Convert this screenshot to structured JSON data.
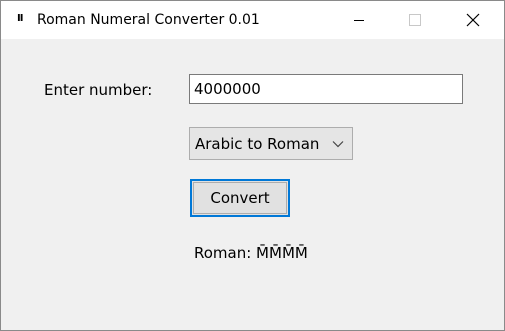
{
  "window": {
    "title": "Roman Numeral Converter 0.01",
    "app_icon_glyph": "II",
    "controls": {
      "minimize_icon": "minimize-icon",
      "maximize_icon": "maximize-icon",
      "close_icon": "close-icon"
    }
  },
  "form": {
    "number_label": "Enter number:",
    "number_value": "4000000",
    "mode_selected": "Arabic to Roman",
    "mode_chevron_icon": "chevron-down-icon",
    "convert_label": "Convert",
    "result_text": "Roman: M̄M̄M̄M̄"
  },
  "colors": {
    "focus_border": "#0078d7",
    "background": "#f0f0f0",
    "titlebar": "#ffffff"
  }
}
